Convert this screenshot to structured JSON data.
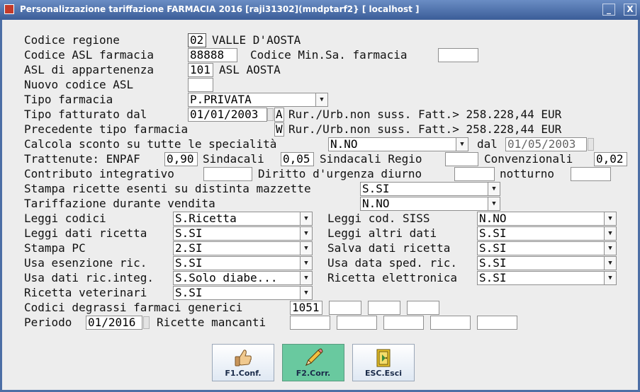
{
  "window": {
    "title": "Personalizzazione tariffazione FARMACIA 2016 [raji31302](mndptarf2} [ localhost ]",
    "minimize": "_",
    "close": "X"
  },
  "form": {
    "codice_regione": {
      "label": "Codice regione",
      "code": "02",
      "name": "VALLE D'AOSTA"
    },
    "codice_asl": {
      "label": "Codice ASL farmacia",
      "value": "88888"
    },
    "codice_minsa": {
      "label": "Codice Min.Sa. farmacia",
      "value": ""
    },
    "asl_appartenenza": {
      "label": "ASL di appartenenza",
      "code": "101",
      "name": "ASL AOSTA"
    },
    "nuovo_codice_asl": {
      "label": "Nuovo codice ASL",
      "value": ""
    },
    "tipo_farmacia": {
      "label": "Tipo farmacia",
      "value": "P.PRIVATA"
    },
    "tipo_fatturato": {
      "label": "Tipo fatturato dal",
      "date": "01/01/2003",
      "code": "A",
      "desc": "Rur./Urb.non suss. Fatt.> 258.228,44 EUR"
    },
    "precedente_tipo": {
      "label": "Precedente tipo farmacia",
      "code": "W",
      "desc": "Rur./Urb.non suss. Fatt.> 258.228,44 EUR"
    },
    "calcola_sconto": {
      "label": "Calcola sconto su tutte le specialità",
      "value": "N.NO",
      "dal_label": "dal",
      "dal": "01/05/2003"
    },
    "trattenute": {
      "label": "Trattenute: ENPAF",
      "enpaf": "0,90",
      "sindacali_label": "Sindacali",
      "sindacali": "0,05",
      "regio_label": "Sindacali Regio",
      "regio": "",
      "conv_label": "Convenzionali",
      "conv": "0,02"
    },
    "contributo": {
      "label": "Contributo integrativo",
      "value": "",
      "diritto_label": "Diritto d'urgenza diurno",
      "diurno": "",
      "notturno_label": "notturno",
      "notturno": ""
    },
    "stampa_esenti": {
      "label": "Stampa ricette esenti su distinta mazzette",
      "value": "S.SI"
    },
    "tariffazione_vendita": {
      "label": "Tariffazione durante vendita",
      "value": "N.NO"
    },
    "leggi_codici": {
      "label": "Leggi codici",
      "value": "S.Ricetta"
    },
    "leggi_siss": {
      "label": "Leggi cod. SISS",
      "value": "N.NO"
    },
    "leggi_dati_ricetta": {
      "label": "Leggi dati ricetta",
      "value": "S.SI"
    },
    "leggi_altri_dati": {
      "label": "Leggi altri dati",
      "value": "S.SI"
    },
    "stampa_pc": {
      "label": "Stampa PC",
      "value": "2.SI"
    },
    "salva_dati": {
      "label": "Salva dati ricetta",
      "value": "S.SI"
    },
    "usa_esenzione": {
      "label": "Usa esenzione ric.",
      "value": "S.SI"
    },
    "usa_data_sped": {
      "label": "Usa data sped. ric.",
      "value": "S.SI"
    },
    "usa_dati_integ": {
      "label": "Usa dati ric.integ.",
      "value": "S.Solo diabe..."
    },
    "ricetta_elettronica": {
      "label": "Ricetta elettronica",
      "value": "S.SI"
    },
    "ricetta_veterinari": {
      "label": "Ricetta veterinari",
      "value": "S.SI"
    },
    "codici_degrassi": {
      "label": "Codici degrassi farmaci generici",
      "values": [
        "1051",
        "",
        "",
        ""
      ]
    },
    "periodo": {
      "label": "Periodo",
      "value": "01/2016",
      "mancanti_label": "Ricette mancanti",
      "mancanti": [
        "",
        "",
        "",
        "",
        ""
      ]
    }
  },
  "buttons": [
    {
      "label": "F1.Conf.",
      "icon": "thumbs-up-icon"
    },
    {
      "label": "F2.Corr.",
      "icon": "pencil-icon"
    },
    {
      "label": "ESC.Esci",
      "icon": "exit-door-icon"
    }
  ],
  "colors": {
    "titlebar": "#4c6ea5",
    "panel": "#ededed",
    "active_button": "#69c99f"
  }
}
